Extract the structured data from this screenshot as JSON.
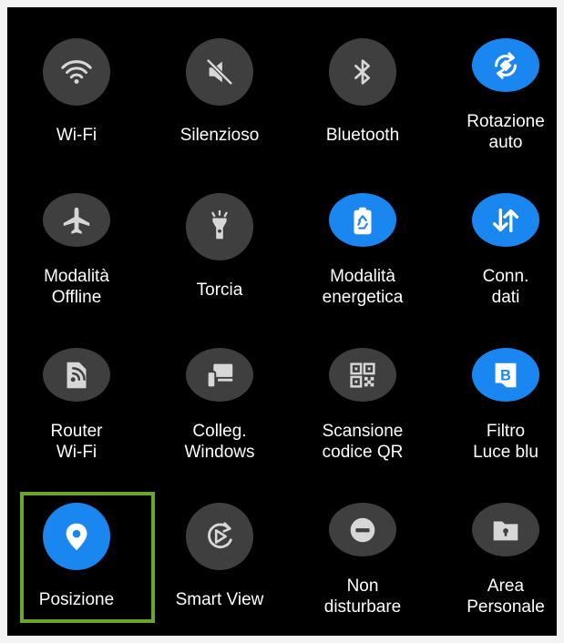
{
  "colors": {
    "accent": "#1a86f0",
    "tile_off": "#3f3f3f",
    "highlight": "#6aa62d"
  },
  "tiles": [
    {
      "label": "Wi-Fi",
      "icon": "wifi-icon",
      "active": false
    },
    {
      "label": "Silenzioso",
      "icon": "mute-icon",
      "active": false
    },
    {
      "label": "Bluetooth",
      "icon": "bluetooth-icon",
      "active": false
    },
    {
      "label": "Rotazione\nauto",
      "icon": "rotation-icon",
      "active": true
    },
    {
      "label": "Modalità\nOffline",
      "icon": "airplane-icon",
      "active": false
    },
    {
      "label": "Torcia",
      "icon": "flashlight-icon",
      "active": false
    },
    {
      "label": "Modalità\nenergetica",
      "icon": "battery-recycle-icon",
      "active": true
    },
    {
      "label": "Conn.\ndati",
      "icon": "data-arrows-icon",
      "active": true
    },
    {
      "label": "Router\nWi-Fi",
      "icon": "hotspot-icon",
      "active": false
    },
    {
      "label": "Colleg.\nWindows",
      "icon": "link-windows-icon",
      "active": false
    },
    {
      "label": "Scansione\ncodice QR",
      "icon": "qr-code-icon",
      "active": false
    },
    {
      "label": "Filtro\nLuce blu",
      "icon": "blue-light-filter-icon",
      "active": true
    },
    {
      "label": "Posizione",
      "icon": "location-pin-icon",
      "active": true
    },
    {
      "label": "Smart View",
      "icon": "smart-view-icon",
      "active": false
    },
    {
      "label": "Non\ndisturbare",
      "icon": "do-not-disturb-icon",
      "active": false
    },
    {
      "label": "Area\nPersonale",
      "icon": "secure-folder-icon",
      "active": false
    }
  ]
}
